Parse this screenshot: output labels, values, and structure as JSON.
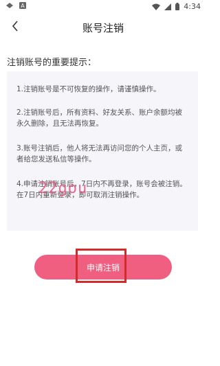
{
  "status_bar": {
    "time": "4:34"
  },
  "app_bar": {
    "title": "账号注销"
  },
  "notice": {
    "heading": "注销账号的重要提示：",
    "items": [
      "1.注销账号是不可恢复的操作，请谨慎操作。",
      "2.注销账号后，所有资料、好友关系、账户余额均被永久删除，且无法再恢复。",
      "3.账号注销后，他人将无法再访问您的个人主页，或者给您发送私信等操作。",
      "4.申请注销账号后，7日内不再登录，账号会被注销。在7日内重新登录，即可取消注销操作。"
    ]
  },
  "watermark": "22gou",
  "submit_label": "申请注销",
  "colors": {
    "accent": "#f15f80",
    "highlight": "#d42a2a",
    "panel": "#f5f5fa"
  }
}
